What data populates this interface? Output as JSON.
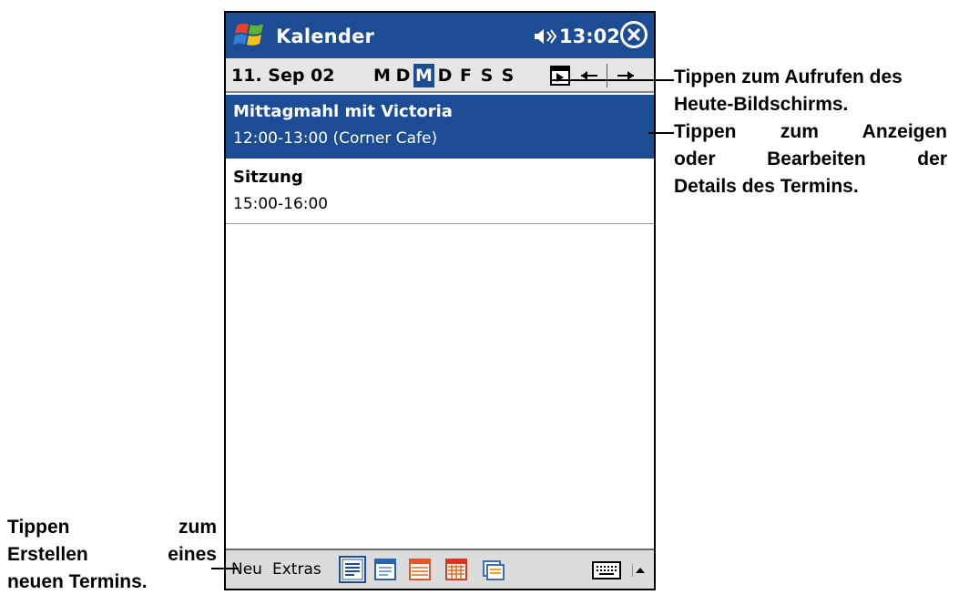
{
  "titlebar": {
    "app_title": "Kalender",
    "time": "13:02",
    "start_icon": "windows-flag-icon",
    "sound_icon": "speaker-icon",
    "close_icon": "close-icon"
  },
  "datebar": {
    "date": "11. Sep 02",
    "weekdays": [
      "M",
      "D",
      "M",
      "D",
      "F",
      "S",
      "S"
    ],
    "selected_weekday_index": 2,
    "today_icon": "go-to-today-icon",
    "prev_icon": "arrow-left-icon",
    "next_icon": "arrow-right-icon"
  },
  "appointments": [
    {
      "title": "Mittagmahl mit Victoria",
      "detail": "12:00-13:00 (Corner Cafe)",
      "selected": true
    },
    {
      "title": "Sitzung",
      "detail": "15:00-16:00",
      "selected": false
    }
  ],
  "menubar": {
    "new_label": "Neu",
    "tools_label": "Extras",
    "view_icons": [
      "agenda-view-icon",
      "day-view-icon",
      "week-view-icon",
      "month-view-icon",
      "year-view-icon"
    ],
    "keyboard_icon": "keyboard-icon",
    "sip_icon": "arrow-up-icon"
  },
  "callouts": {
    "today": [
      "Tippen zum Aufrufen des",
      "Heute-Bildschirms."
    ],
    "details": [
      "Tippen zum Anzeigen",
      "oder Bearbeiten der",
      "Details des Termins."
    ],
    "new": [
      "Tippen zum",
      "Erstellen eines",
      "neuen Termins."
    ]
  },
  "colors": {
    "accent": "#1c4c93",
    "toolbar": "#dcdcdc",
    "datebar": "#e6e6e6"
  }
}
